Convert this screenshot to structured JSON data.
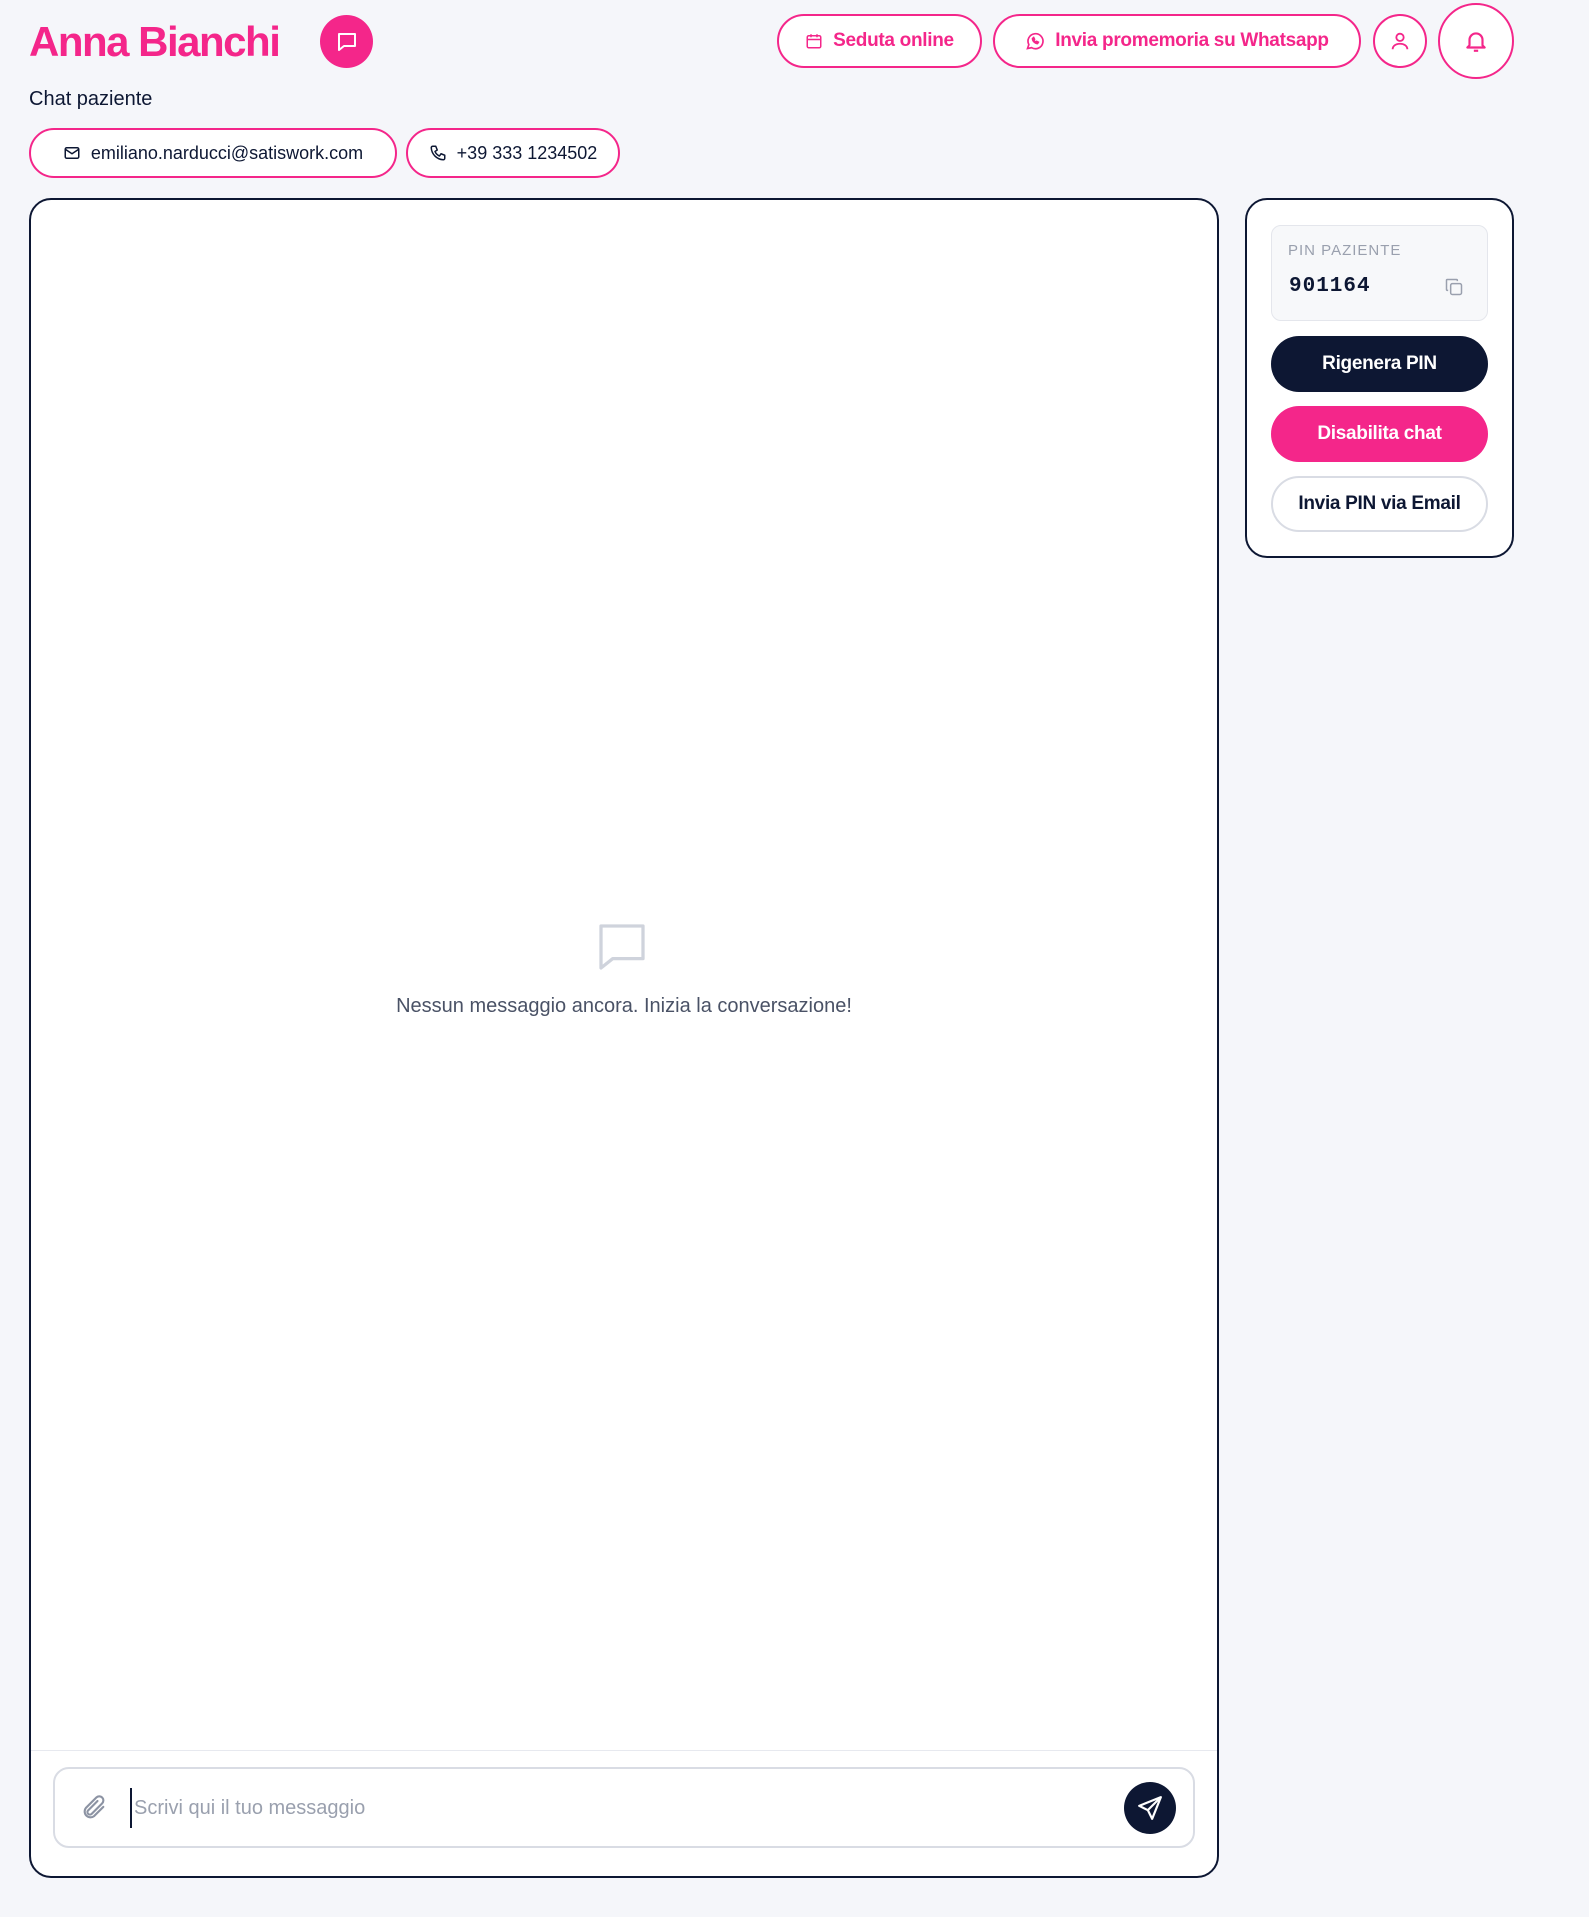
{
  "header": {
    "patient_name": "Anna Bianchi",
    "subtitle": "Chat paziente",
    "seduta_label": "Seduta online",
    "whatsapp_label": "Invia promemoria su Whatsapp"
  },
  "contact": {
    "email": "emiliano.narducci@satiswork.com",
    "phone": "+39 333 1234502"
  },
  "chat": {
    "empty_message": "Nessun messaggio ancora. Inizia la conversazione!",
    "input_placeholder": "Scrivi qui il tuo messaggio",
    "input_value": ""
  },
  "pin_panel": {
    "label": "PIN PAZIENTE",
    "value": "901164",
    "rigenera_label": "Rigenera PIN",
    "disabilita_label": "Disabilita chat",
    "invia_email_label": "Invia PIN via Email"
  },
  "icons": {
    "chat_badge": "chat-icon",
    "seduta": "calendar-icon",
    "whatsapp": "whatsapp-icon",
    "user": "user-icon",
    "bell": "bell-icon",
    "email": "mail-icon",
    "phone": "phone-icon",
    "empty": "message-square-icon",
    "attach": "paperclip-icon",
    "send": "send-icon",
    "copy": "copy-icon"
  },
  "colors": {
    "accent": "#f4268a",
    "dark": "#0d1733",
    "background": "#f5f6fa"
  }
}
